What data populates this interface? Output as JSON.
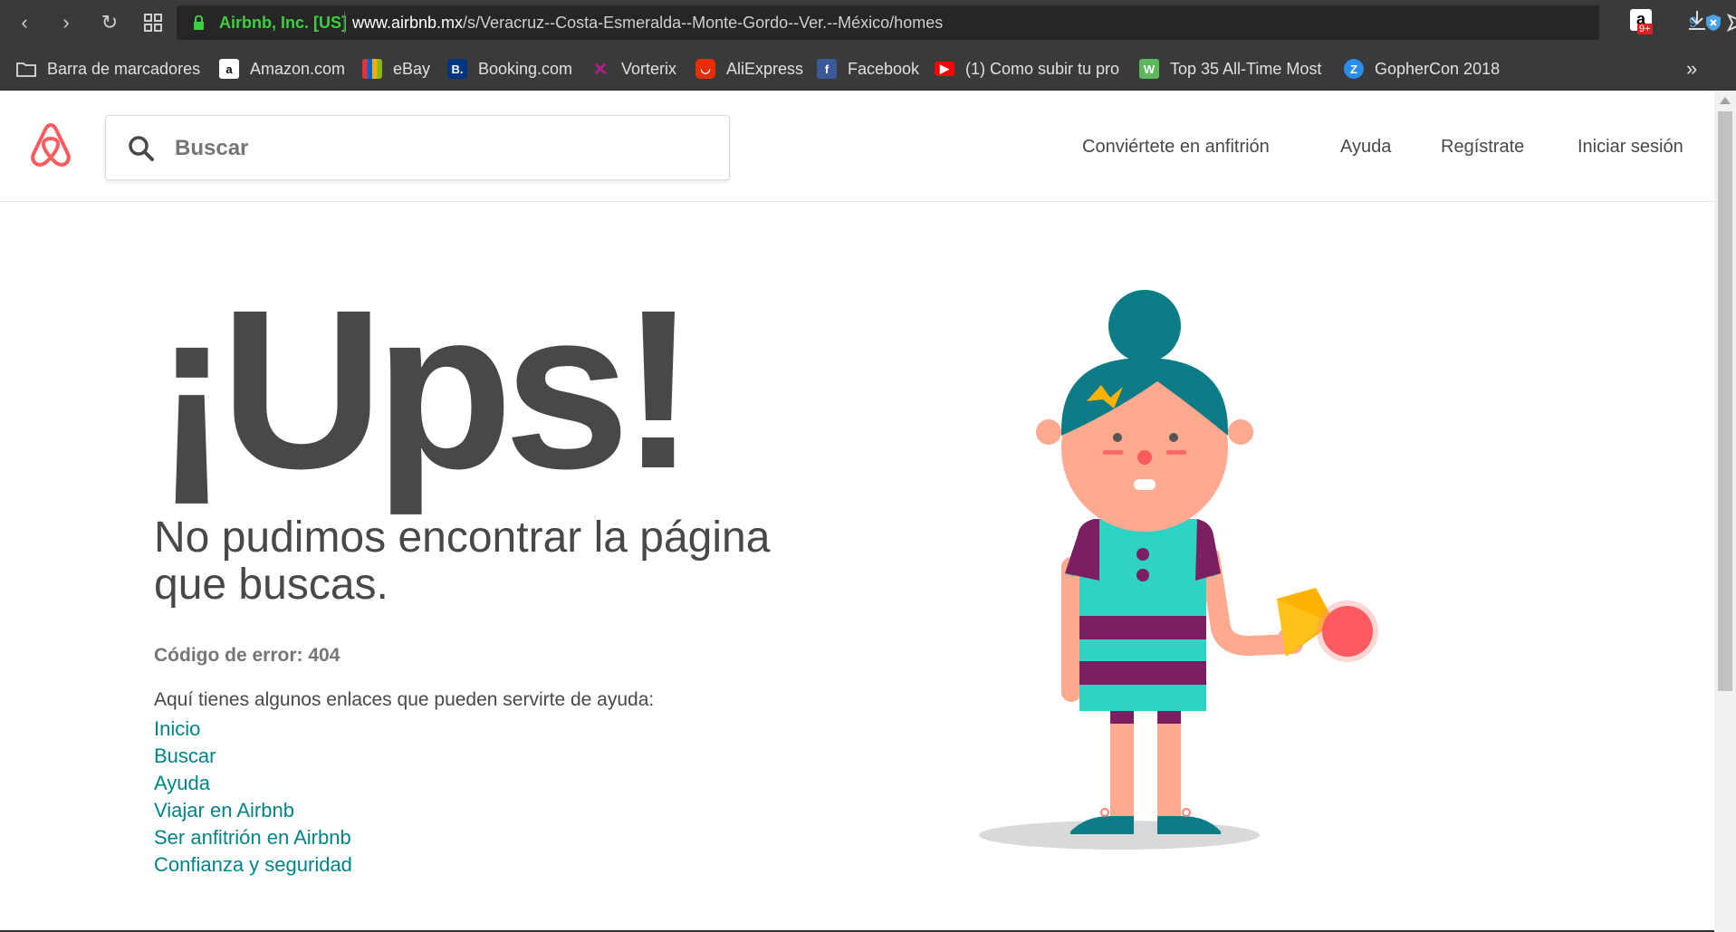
{
  "browser": {
    "site_identity": "Airbnb, Inc. [US]",
    "url_domain": "www.airbnb.mx",
    "url_path": "/s/Veracruz--Costa-Esmeralda--Monte-Gordo--Ver.--México/homes",
    "extension_badge_count": "9",
    "amazon_badge": "9+"
  },
  "bookmarks": {
    "folder_label": "Barra de marcadores",
    "items": [
      {
        "label": "Amazon.com",
        "icon": "amazon-icon",
        "color": "#ffffff"
      },
      {
        "label": "eBay",
        "icon": "ebay-icon",
        "color": "#e53238"
      },
      {
        "label": "Booking.com",
        "icon": "booking-icon",
        "color": "#003580"
      },
      {
        "label": "Vorterix",
        "icon": "vorterix-icon",
        "color": "#8a1a8a"
      },
      {
        "label": "AliExpress",
        "icon": "aliexpress-icon",
        "color": "#e62e04"
      },
      {
        "label": "Facebook",
        "icon": "facebook-icon",
        "color": "#3b5998"
      },
      {
        "label": "(1) Como subir tu pro",
        "icon": "youtube-icon",
        "color": "#ff0000"
      },
      {
        "label": "Top 35 All-Time Most",
        "icon": "w-icon",
        "color": "#5cb85c"
      },
      {
        "label": "GopherCon 2018",
        "icon": "gophercon-icon",
        "color": "#2a8de8"
      }
    ],
    "overflow_label": "»"
  },
  "header": {
    "search_placeholder": "Buscar",
    "nav": {
      "host": "Conviértete en anfitrión",
      "help": "Ayuda",
      "signup": "Regístrate",
      "login": "Iniciar sesión"
    }
  },
  "main": {
    "headline": "¡Ups!",
    "subtitle": "No pudimos encontrar la página que buscas.",
    "error_code": "Código de error: 404",
    "help_intro": "Aquí tienes algunos enlaces que pueden servirte de ayuda:",
    "links": [
      "Inicio",
      "Buscar",
      "Ayuda",
      "Viajar en Airbnb",
      "Ser anfitrión en Airbnb",
      "Confianza y seguridad"
    ]
  },
  "colors": {
    "brand": "#FF5A5F",
    "link": "#008489",
    "text": "#484848"
  }
}
